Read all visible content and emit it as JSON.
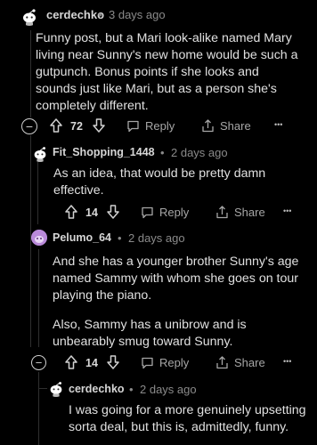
{
  "comments": [
    {
      "username": "cerdechko",
      "time": "3 days ago",
      "body": "Funny post, but a Mari look-alike named Mary living near Sunny's new home would be such a gutpunch. Bonus points if she looks and sounds just like Mari, but as a person she's completely different.",
      "votes": "72",
      "reply_label": "Reply",
      "share_label": "Share"
    },
    {
      "username": "Fit_Shopping_1448",
      "time": "2 days ago",
      "body": "As an idea, that would be pretty damn effective.",
      "votes": "14",
      "reply_label": "Reply",
      "share_label": "Share"
    },
    {
      "username": "Pelumo_64",
      "time": "2 days ago",
      "body_p1": "And she has a younger brother Sunny's age named Sammy with whom she goes on tour playing the piano.",
      "body_p2": "Also, Sammy has a unibrow and is unbearably smug toward Sunny.",
      "votes": "14",
      "reply_label": "Reply",
      "share_label": "Share"
    },
    {
      "username": "cerdechko",
      "time": "2 days ago",
      "body": "I was going for a more genuinely upsetting sorta deal, but this is, admittedly, funny."
    }
  ],
  "separator": "•",
  "more_glyph": "•••",
  "collapse_glyph": "−",
  "colors": {
    "background": "#000000",
    "text": "#e0e0e0",
    "meta": "#8a8a8a",
    "thread_line": "#2f2f2f",
    "pelumo_avatar": "#b98ad9"
  },
  "icons": [
    "snoo-avatar-icon",
    "upvote-icon",
    "downvote-icon",
    "reply-bubble-icon",
    "share-icon",
    "more-icon",
    "collapse-icon"
  ]
}
